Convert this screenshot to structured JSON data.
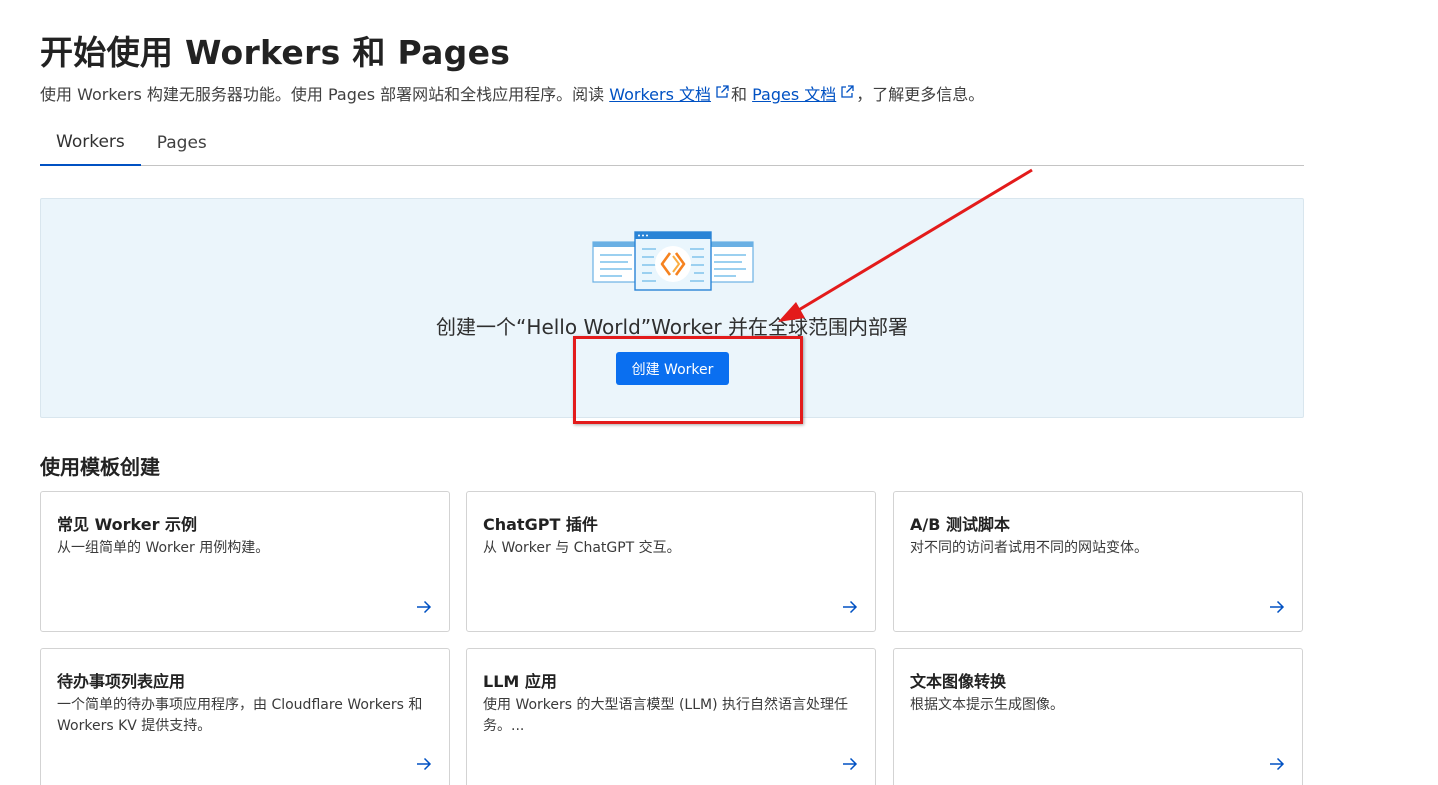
{
  "page": {
    "title": "开始使用 Workers 和 Pages",
    "intro": {
      "prefix": "使用 Workers 构建无服务器功能。使用 Pages 部署网站和全栈应用程序。阅读 ",
      "link1": "Workers 文档",
      "middle": "和 ",
      "link2": "Pages 文档",
      "suffix": "，了解更多信息。"
    }
  },
  "tabs": [
    {
      "label": "Workers",
      "active": true
    },
    {
      "label": "Pages",
      "active": false
    }
  ],
  "hero": {
    "text": "创建一个“Hello World”Worker 并在全球范围内部署",
    "button_label": "创建 Worker"
  },
  "templates": {
    "section_title": "使用模板创建",
    "cards": [
      {
        "title": "常见 Worker 示例",
        "description": "从一组简单的 Worker 用例构建。"
      },
      {
        "title": "ChatGPT 插件",
        "description": "从 Worker 与 ChatGPT 交互。"
      },
      {
        "title": "A/B 测试脚本",
        "description": "对不同的访问者试用不同的网站变体。"
      },
      {
        "title": "待办事项列表应用",
        "description": "一个简单的待办事项应用程序，由 Cloudflare Workers 和 Workers KV 提供支持。"
      },
      {
        "title": "LLM 应用",
        "description": "使用 Workers 的大型语言模型 (LLM) 执行自然语言处理任务。..."
      },
      {
        "title": "文本图像转换",
        "description": "根据文本提示生成图像。"
      }
    ]
  },
  "colors": {
    "accent": "#0051c3",
    "button": "#0a6ff0",
    "hero_bg": "#ebf5fb",
    "annotation": "#e31b1b"
  },
  "icons": {
    "external_link": "external-link-icon",
    "arrow": "arrow-right-icon"
  }
}
